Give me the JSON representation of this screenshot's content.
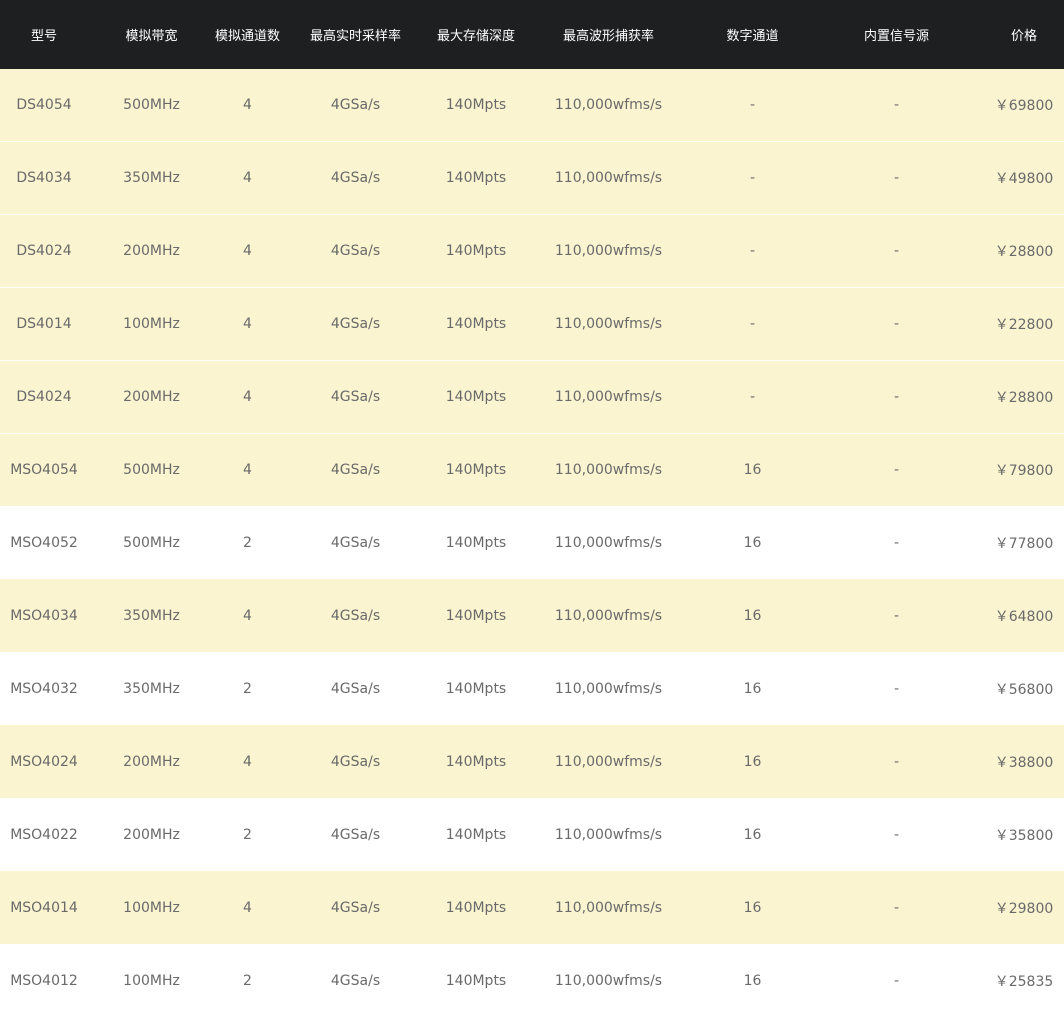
{
  "table": {
    "headers": [
      "型号",
      "模拟带宽",
      "模拟通道数",
      "最高实时采样率",
      "最大存储深度",
      "最高波形捕获率",
      "数字通道",
      "内置信号源",
      "价格"
    ],
    "rows": [
      {
        "model": "DS4054",
        "bandwidth": "500MHz",
        "channels": "4",
        "sample_rate": "4GSa/s",
        "memory_depth": "140Mpts",
        "capture_rate": "110,000wfms/s",
        "digital_channels": "-",
        "signal_source": "-",
        "price": "￥69800"
      },
      {
        "model": "DS4034",
        "bandwidth": "350MHz",
        "channels": "4",
        "sample_rate": "4GSa/s",
        "memory_depth": "140Mpts",
        "capture_rate": "110,000wfms/s",
        "digital_channels": "-",
        "signal_source": "-",
        "price": "￥49800"
      },
      {
        "model": "DS4024",
        "bandwidth": "200MHz",
        "channels": "4",
        "sample_rate": "4GSa/s",
        "memory_depth": "140Mpts",
        "capture_rate": "110,000wfms/s",
        "digital_channels": "-",
        "signal_source": "-",
        "price": "￥28800"
      },
      {
        "model": "DS4014",
        "bandwidth": "100MHz",
        "channels": "4",
        "sample_rate": "4GSa/s",
        "memory_depth": "140Mpts",
        "capture_rate": "110,000wfms/s",
        "digital_channels": "-",
        "signal_source": "-",
        "price": "￥22800"
      },
      {
        "model": "DS4024",
        "bandwidth": "200MHz",
        "channels": "4",
        "sample_rate": "4GSa/s",
        "memory_depth": "140Mpts",
        "capture_rate": "110,000wfms/s",
        "digital_channels": "-",
        "signal_source": "-",
        "price": "￥28800"
      },
      {
        "model": "MSO4054",
        "bandwidth": "500MHz",
        "channels": "4",
        "sample_rate": "4GSa/s",
        "memory_depth": "140Mpts",
        "capture_rate": "110,000wfms/s",
        "digital_channels": "16",
        "signal_source": "-",
        "price": "￥79800"
      },
      {
        "model": "MSO4052",
        "bandwidth": "500MHz",
        "channels": "2",
        "sample_rate": "4GSa/s",
        "memory_depth": "140Mpts",
        "capture_rate": "110,000wfms/s",
        "digital_channels": "16",
        "signal_source": "-",
        "price": "￥77800"
      },
      {
        "model": "MSO4034",
        "bandwidth": "350MHz",
        "channels": "4",
        "sample_rate": "4GSa/s",
        "memory_depth": "140Mpts",
        "capture_rate": "110,000wfms/s",
        "digital_channels": "16",
        "signal_source": "-",
        "price": "￥64800"
      },
      {
        "model": "MSO4032",
        "bandwidth": "350MHz",
        "channels": "2",
        "sample_rate": "4GSa/s",
        "memory_depth": "140Mpts",
        "capture_rate": "110,000wfms/s",
        "digital_channels": "16",
        "signal_source": "-",
        "price": "￥56800"
      },
      {
        "model": "MSO4024",
        "bandwidth": "200MHz",
        "channels": "4",
        "sample_rate": "4GSa/s",
        "memory_depth": "140Mpts",
        "capture_rate": "110,000wfms/s",
        "digital_channels": "16",
        "signal_source": "-",
        "price": "￥38800"
      },
      {
        "model": "MSO4022",
        "bandwidth": "200MHz",
        "channels": "2",
        "sample_rate": "4GSa/s",
        "memory_depth": "140Mpts",
        "capture_rate": "110,000wfms/s",
        "digital_channels": "16",
        "signal_source": "-",
        "price": "￥35800"
      },
      {
        "model": "MSO4014",
        "bandwidth": "100MHz",
        "channels": "4",
        "sample_rate": "4GSa/s",
        "memory_depth": "140Mpts",
        "capture_rate": "110,000wfms/s",
        "digital_channels": "16",
        "signal_source": "-",
        "price": "￥29800"
      },
      {
        "model": "MSO4012",
        "bandwidth": "100MHz",
        "channels": "2",
        "sample_rate": "4GSa/s",
        "memory_depth": "140Mpts",
        "capture_rate": "110,000wfms/s",
        "digital_channels": "16",
        "signal_source": "-",
        "price": "￥25835"
      }
    ]
  },
  "colors": {
    "header_background": "#1e1f21",
    "header_text": "#ffffff",
    "row_tint": "#faf4d0",
    "row_plain": "#ffffff",
    "cell_text": "#6a6a6a"
  }
}
